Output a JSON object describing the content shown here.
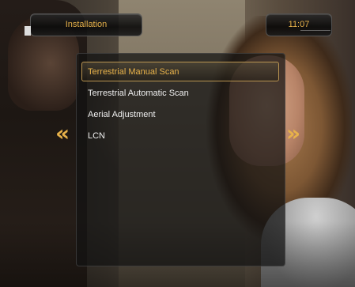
{
  "header": {
    "title": "Installation",
    "clock": "11:07"
  },
  "menu": {
    "items": [
      {
        "label": "Terrestrial Manual Scan",
        "selected": true
      },
      {
        "label": "Terrestrial Automatic Scan",
        "selected": false
      },
      {
        "label": "Aerial Adjustment",
        "selected": false
      },
      {
        "label": "LCN",
        "selected": false
      }
    ]
  },
  "nav": {
    "left_glyph": "«",
    "right_glyph": "»",
    "left_icon": "double-chevron-left-icon",
    "right_icon": "double-chevron-right-icon"
  },
  "colors": {
    "accent": "#e8b24a",
    "menu_text": "#f0f0f0",
    "selection_border": "#b99450"
  }
}
